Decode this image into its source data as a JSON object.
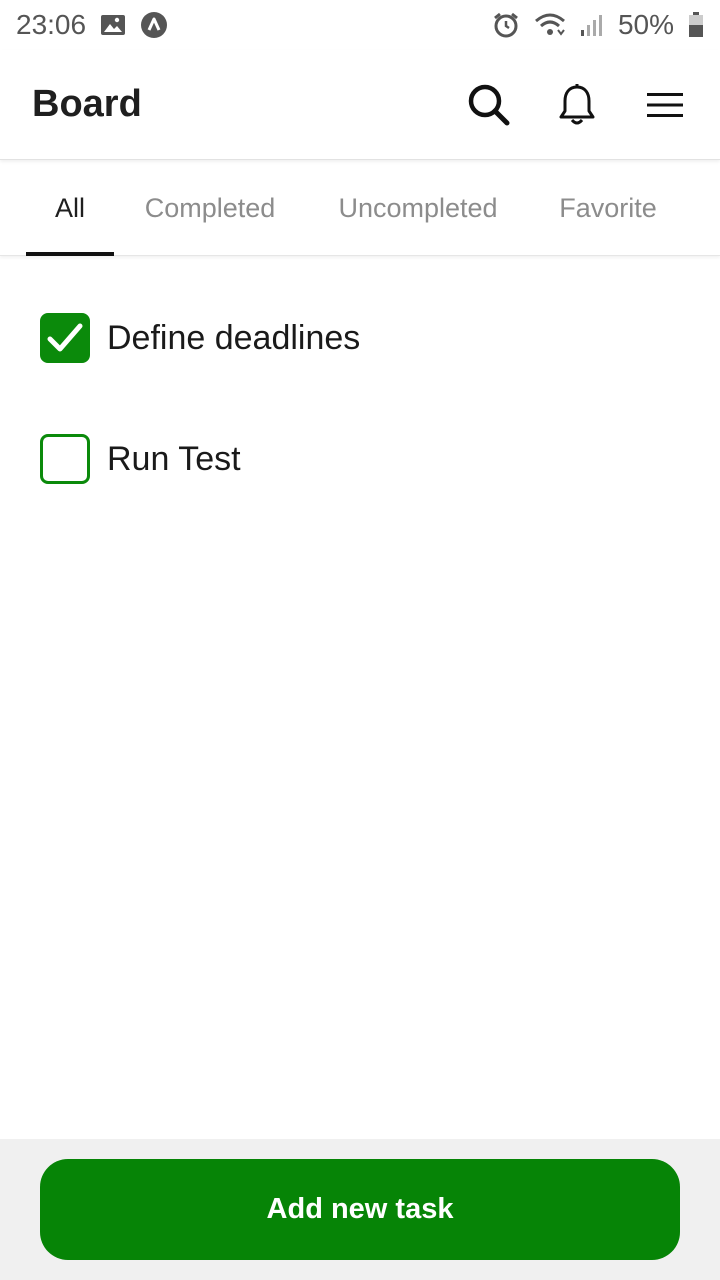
{
  "status_bar": {
    "time": "23:06",
    "battery": "50%",
    "left_icons": [
      "image-icon",
      "app-notification-icon"
    ],
    "right_icons": [
      "alarm-icon",
      "wifi-icon",
      "signal-icon",
      "battery-icon"
    ]
  },
  "app_bar": {
    "title": "Board",
    "actions": [
      "search-icon",
      "bell-icon",
      "menu-icon"
    ]
  },
  "tabs": [
    {
      "label": "All",
      "active": true
    },
    {
      "label": "Completed",
      "active": false
    },
    {
      "label": "Uncompleted",
      "active": false
    },
    {
      "label": "Favorite",
      "active": false
    }
  ],
  "tasks": [
    {
      "label": "Define deadlines",
      "completed": true
    },
    {
      "label": "Run Test",
      "completed": false
    }
  ],
  "footer": {
    "add_button_label": "Add new task"
  },
  "colors": {
    "accent": "#068406",
    "checkbox": "#0b8a0b",
    "footer_bg": "#f0f0f0",
    "tab_inactive": "#8c8c8c"
  }
}
